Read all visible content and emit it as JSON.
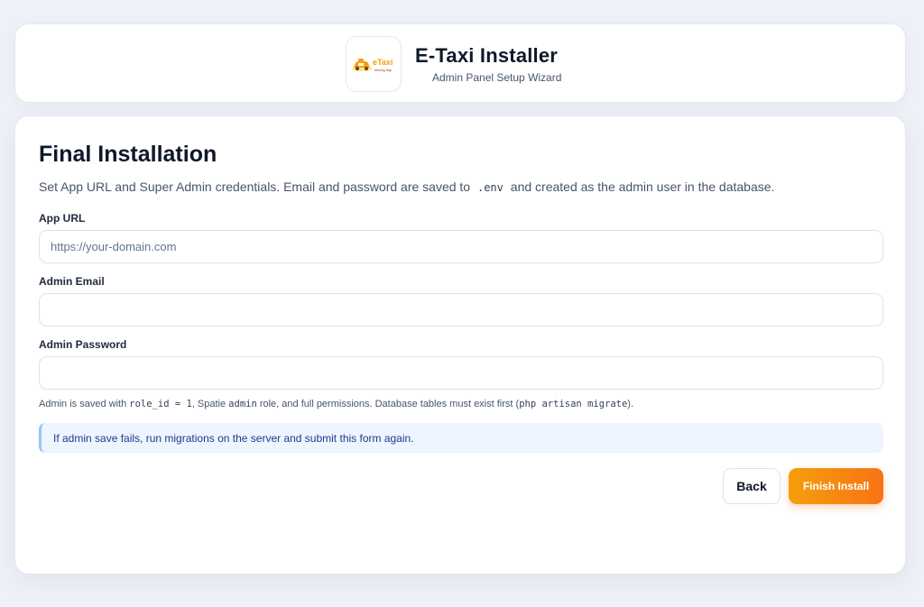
{
  "header": {
    "logo_text": "eTaxi",
    "logo_tagline": "Moving Day",
    "title": "E-Taxi Installer",
    "subtitle": "Admin Panel Setup Wizard"
  },
  "main": {
    "title": "Final Installation",
    "intro_before": "Set App URL and Super Admin credentials. Email and password are saved to",
    "intro_code": ".env",
    "intro_after": "and created as the admin user in the database.",
    "fields": {
      "app_url": {
        "label": "App URL",
        "value": "",
        "placeholder": "https://your-domain.com"
      },
      "admin_email": {
        "label": "Admin Email",
        "value": "",
        "placeholder": ""
      },
      "admin_password": {
        "label": "Admin Password",
        "value": "",
        "placeholder": ""
      }
    },
    "hint": {
      "part1": "Admin is saved with ",
      "code1": "role_id = 1",
      "part2": ", Spatie ",
      "code2": "admin",
      "part3": " role, and full permissions. Database tables must exist first (",
      "code3": "php artisan migrate",
      "part4": ")."
    },
    "info": "If admin save fails, run migrations on the server and submit this form again.",
    "buttons": {
      "back": "Back",
      "finish": "Finish Install"
    }
  },
  "colors": {
    "page_bg": "#eef1f8",
    "card_bg": "#ffffff",
    "accent_start": "#f59e0b",
    "accent_end": "#f97316",
    "info_bg": "#eef5ff",
    "info_border": "#93c5fd",
    "text_dark": "#0f172a",
    "text_muted": "#475569"
  },
  "icons": {
    "logo": "taxi-car-icon"
  }
}
